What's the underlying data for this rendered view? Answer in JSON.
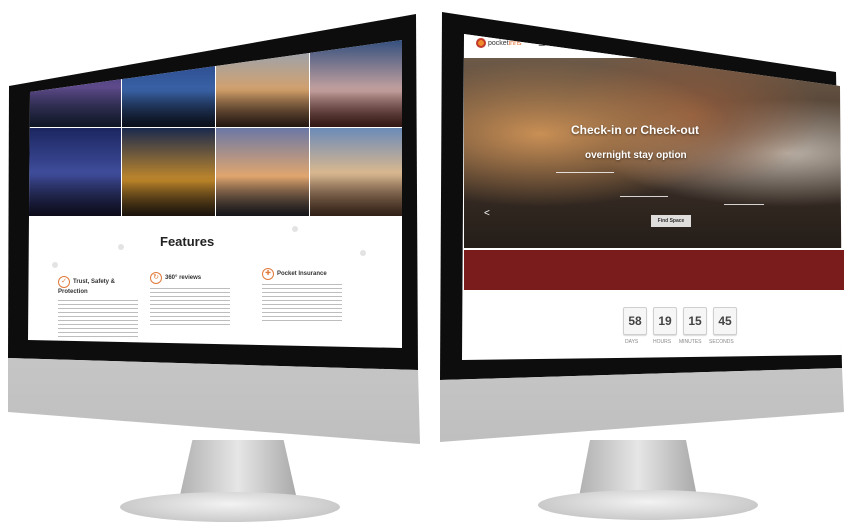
{
  "left_screen": {
    "features_title": "Features",
    "features": [
      {
        "title": "Trust, Safety & Protection",
        "icon": "shield-icon"
      },
      {
        "title": "360° reviews",
        "icon": "review-icon"
      },
      {
        "title": "Pocket Insurance",
        "icon": "insurance-icon"
      }
    ]
  },
  "right_screen": {
    "logo": {
      "prefix": "pocket",
      "accent": "inns"
    },
    "menu_icon": "☰",
    "hero": {
      "headline_1": "Check-in or Check-out",
      "headline_2": "overnight stay option"
    },
    "find_button": "Find Space",
    "countdown": {
      "values": [
        "58",
        "19",
        "15",
        "45"
      ],
      "labels": [
        "DAYS",
        "HOURS",
        "MINUTES",
        "SECONDS"
      ]
    }
  },
  "colors": {
    "brand_orange": "#e06b2a",
    "promo_band": "#7a1c1c"
  }
}
